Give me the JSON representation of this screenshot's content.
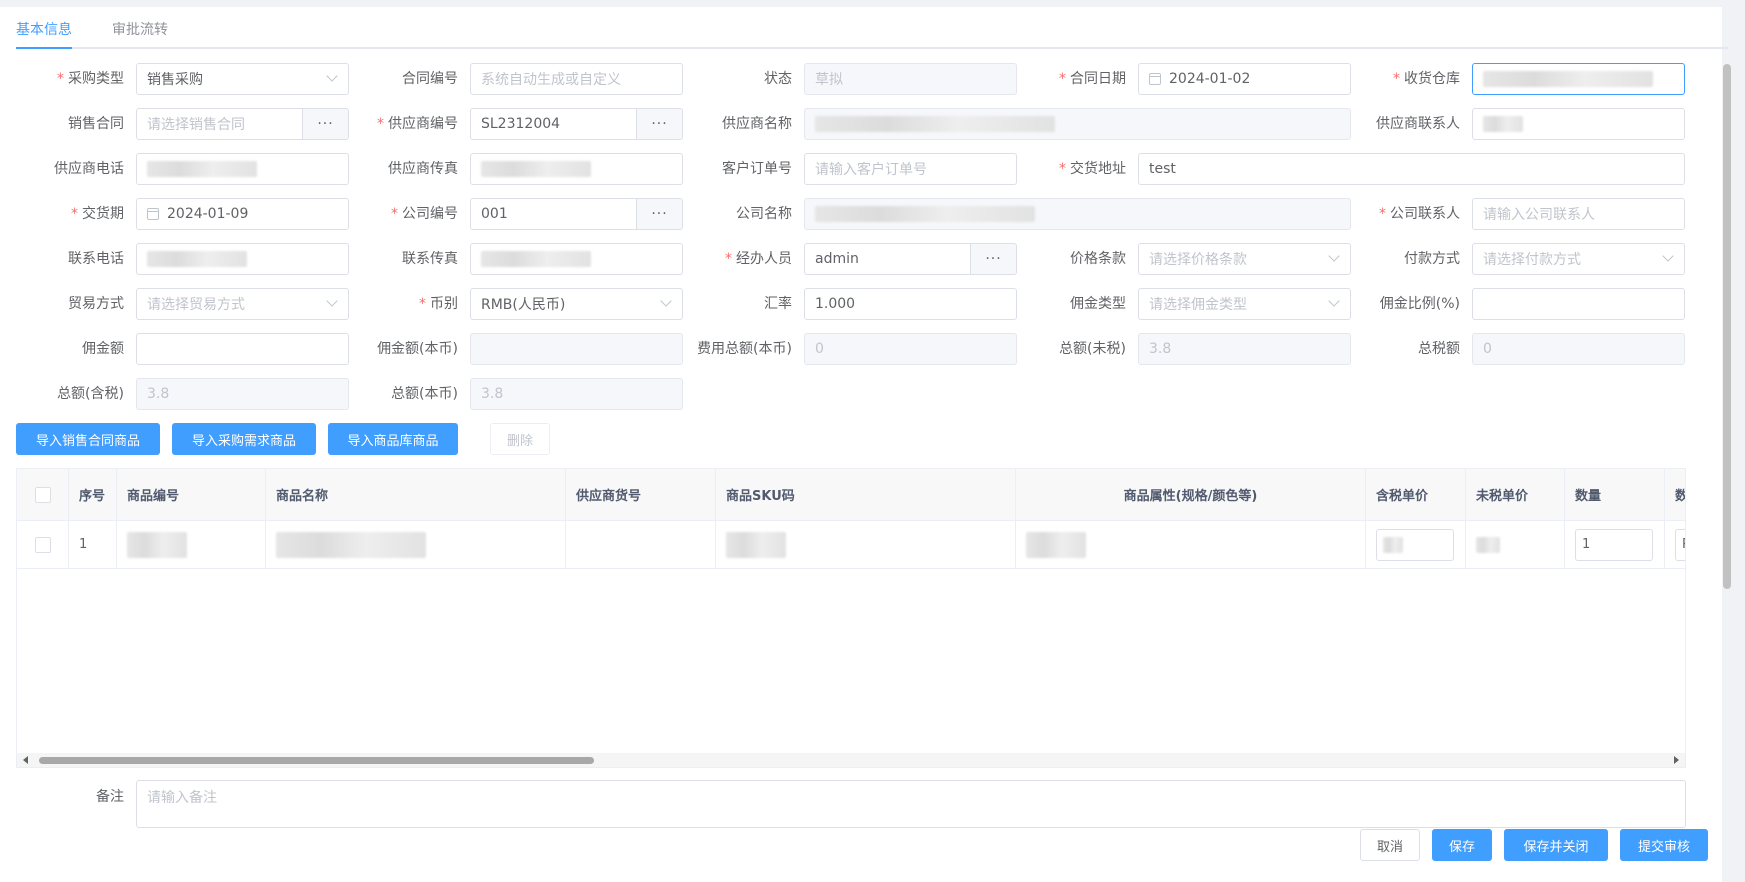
{
  "tabs": [
    {
      "label": "基本信息",
      "active": true
    },
    {
      "label": "审批流转",
      "active": false
    }
  ],
  "form": {
    "purchase_type": {
      "label": "采购类型",
      "value": "销售采购"
    },
    "contract_no": {
      "label": "合同编号",
      "placeholder": "系统自动生成或自定义"
    },
    "status": {
      "label": "状态",
      "value": "草拟"
    },
    "contract_date": {
      "label": "合同日期",
      "value": "2024-01-02"
    },
    "warehouse": {
      "label": "收货仓库"
    },
    "sales_contract": {
      "label": "销售合同",
      "placeholder": "请选择销售合同"
    },
    "supplier_code": {
      "label": "供应商编号",
      "value": "SL2312004"
    },
    "supplier_name": {
      "label": "供应商名称"
    },
    "supplier_contact": {
      "label": "供应商联系人"
    },
    "supplier_phone": {
      "label": "供应商电话"
    },
    "supplier_fax": {
      "label": "供应商传真"
    },
    "customer_order": {
      "label": "客户订单号",
      "placeholder": "请输入客户订单号"
    },
    "delivery_address": {
      "label": "交货地址",
      "value": "test"
    },
    "delivery_date": {
      "label": "交货期",
      "value": "2024-01-09"
    },
    "company_code": {
      "label": "公司编号",
      "value": "001"
    },
    "company_name": {
      "label": "公司名称"
    },
    "company_contact": {
      "label": "公司联系人",
      "placeholder": "请输入公司联系人"
    },
    "contact_phone": {
      "label": "联系电话"
    },
    "contact_fax": {
      "label": "联系传真"
    },
    "handler": {
      "label": "经办人员",
      "value": "admin"
    },
    "price_terms": {
      "label": "价格条款",
      "placeholder": "请选择价格条款"
    },
    "payment_method": {
      "label": "付款方式",
      "placeholder": "请选择付款方式"
    },
    "trade_method": {
      "label": "贸易方式",
      "placeholder": "请选择贸易方式"
    },
    "currency": {
      "label": "币别",
      "value": "RMB(人民币)"
    },
    "exchange_rate": {
      "label": "汇率",
      "value": "1.000"
    },
    "commission_type": {
      "label": "佣金类型",
      "placeholder": "请选择佣金类型"
    },
    "commission_ratio": {
      "label": "佣金比例(%)"
    },
    "commission_amount": {
      "label": "佣金额"
    },
    "commission_local": {
      "label": "佣金额(本币)"
    },
    "fee_total_local": {
      "label": "费用总额(本币)",
      "value": "0"
    },
    "total_excl_tax": {
      "label": "总额(未税)",
      "value": "3.8"
    },
    "total_tax": {
      "label": "总税额",
      "value": "0"
    },
    "total_incl_tax": {
      "label": "总额(含税)",
      "value": "3.8"
    },
    "total_local": {
      "label": "总额(本币)",
      "value": "3.8"
    },
    "dots": "···"
  },
  "actions": {
    "import_sales": "导入销售合同商品",
    "import_demand": "导入采购需求商品",
    "import_library": "导入商品库商品",
    "delete": "删除"
  },
  "table": {
    "columns": [
      "序号",
      "商品编号",
      "商品名称",
      "供应商货号",
      "商品SKU码",
      "商品属性(规格/颜色等)",
      "含税单价",
      "未税单价",
      "数量",
      "数"
    ],
    "rows": [
      {
        "index": "1",
        "quantity": "1",
        "extra": "P"
      }
    ]
  },
  "remark": {
    "label": "备注",
    "placeholder": "请输入备注"
  },
  "footer": {
    "cancel": "取消",
    "save": "保存",
    "save_close": "保存并关闭",
    "submit": "提交审核"
  },
  "colors": {
    "primary": "#409eff",
    "required": "#f56c6c"
  }
}
